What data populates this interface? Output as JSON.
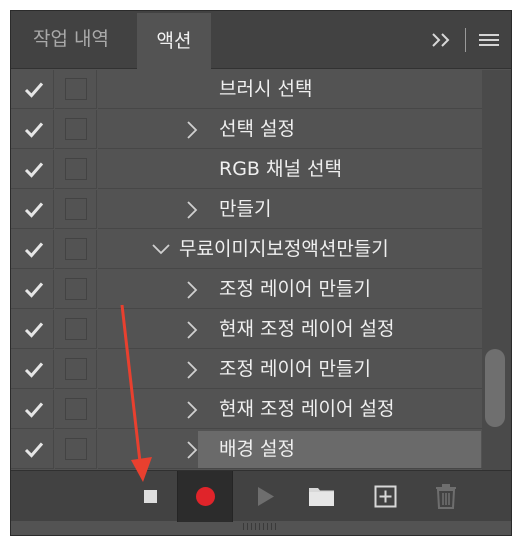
{
  "tabs": [
    {
      "label": "작업 내역",
      "active": false
    },
    {
      "label": "액션",
      "active": true
    }
  ],
  "panel_menu": {
    "collapse": "panel-collapse-icon",
    "menu": "hamburger-menu-icon"
  },
  "actions": [
    {
      "label": "브러시 선택",
      "level": 2,
      "expandable": false,
      "expanded": false,
      "checked": true,
      "selected": false
    },
    {
      "label": "선택 설정",
      "level": 2,
      "expandable": true,
      "expanded": false,
      "checked": true,
      "selected": false
    },
    {
      "label": "RGB 채널 선택",
      "level": 2,
      "expandable": false,
      "expanded": false,
      "checked": true,
      "selected": false
    },
    {
      "label": "만들기",
      "level": 2,
      "expandable": true,
      "expanded": false,
      "checked": true,
      "selected": false
    },
    {
      "label": "무료이미지보정액션만들기",
      "level": 1,
      "expandable": true,
      "expanded": true,
      "checked": true,
      "selected": false
    },
    {
      "label": "조정 레이어 만들기",
      "level": 2,
      "expandable": true,
      "expanded": false,
      "checked": true,
      "selected": false
    },
    {
      "label": "현재 조정 레이어 설정",
      "level": 2,
      "expandable": true,
      "expanded": false,
      "checked": true,
      "selected": false
    },
    {
      "label": "조정 레이어 만들기",
      "level": 2,
      "expandable": true,
      "expanded": false,
      "checked": true,
      "selected": false
    },
    {
      "label": "현재 조정 레이어 설정",
      "level": 2,
      "expandable": true,
      "expanded": false,
      "checked": true,
      "selected": false
    },
    {
      "label": "배경 설정",
      "level": 2,
      "expandable": true,
      "expanded": false,
      "checked": true,
      "selected": true
    }
  ],
  "toolbar": [
    "stop-icon",
    "record-icon",
    "play-icon",
    "folder-icon",
    "new-action-icon",
    "trash-icon"
  ],
  "colors": {
    "panel": "#535353",
    "record": "#e0242a",
    "annotation_arrow": "#e8402f"
  }
}
